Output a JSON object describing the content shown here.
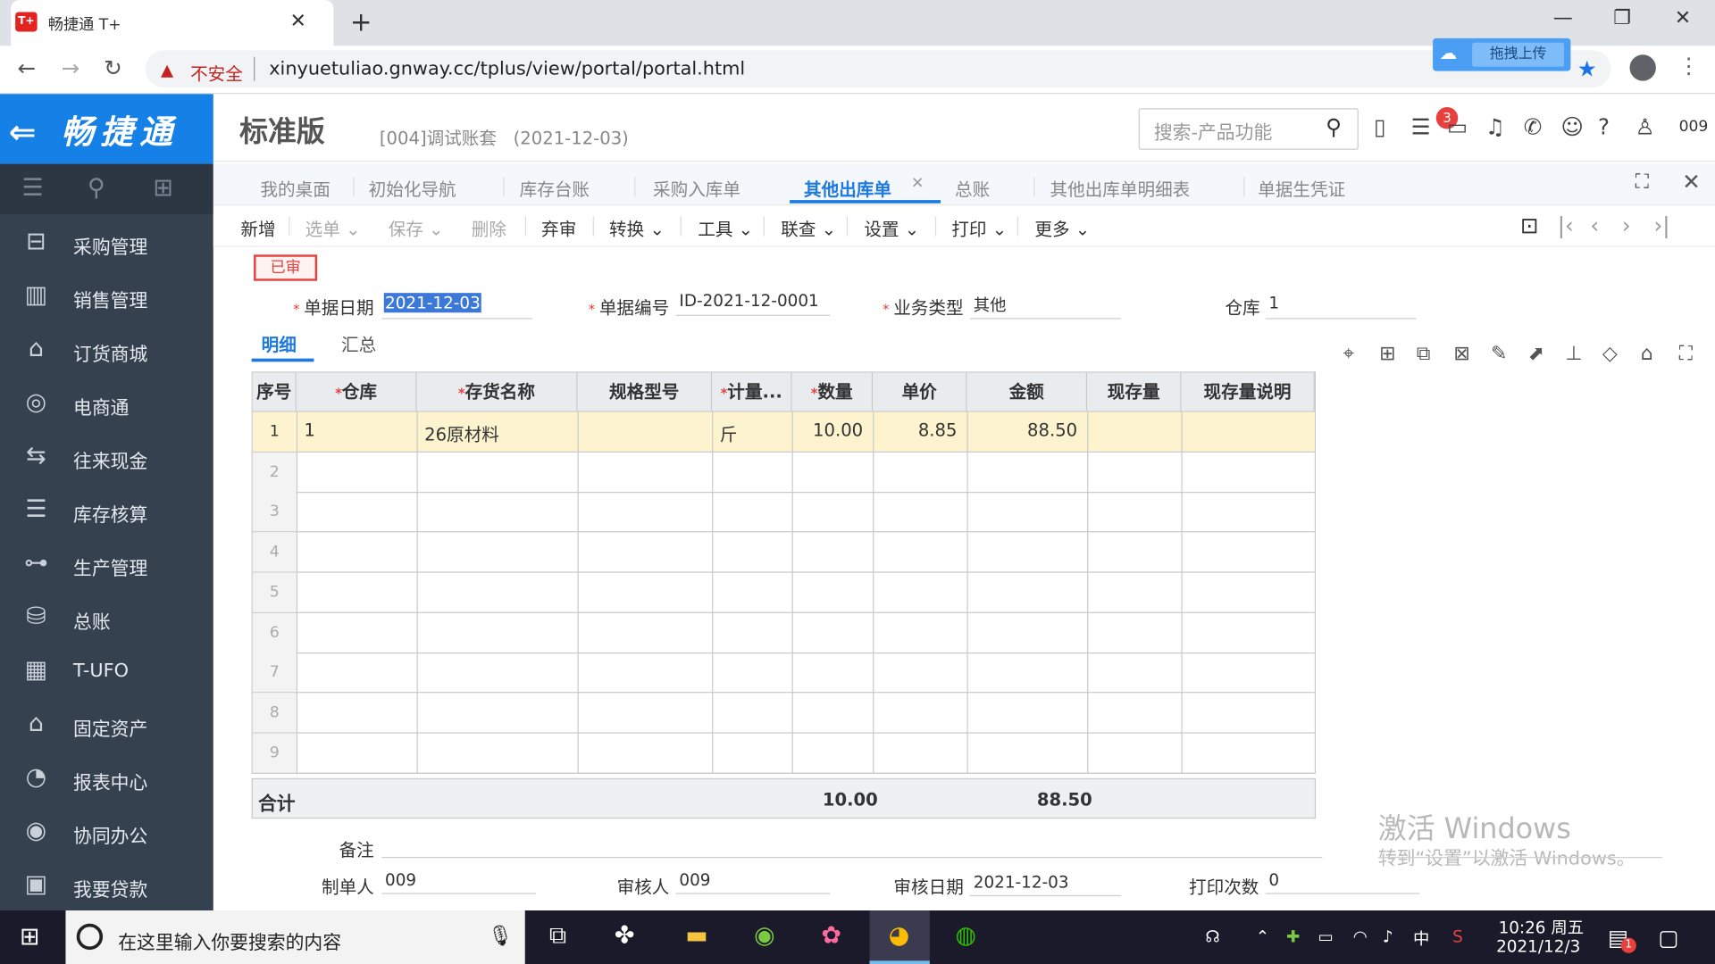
{
  "browser": {
    "tab_title": "畅捷通 T+",
    "tab_icon_text": "T+",
    "security_label": "不安全",
    "url": "xinyuetuliao.gnway.cc/tplus/view/portal/portal.html",
    "extension_label": "拖拽上传"
  },
  "app": {
    "logo": "畅捷通",
    "edition": "标准版",
    "account": "[004]调试账套",
    "account_date": "(2021-12-03)",
    "search_placeholder": "搜索-产品功能",
    "notification_count": "3",
    "user": "009"
  },
  "sidebar": {
    "items": [
      {
        "label": "采购管理",
        "icon": "purchase-icon"
      },
      {
        "label": "销售管理",
        "icon": "sales-icon"
      },
      {
        "label": "订货商城",
        "icon": "mall-icon"
      },
      {
        "label": "电商通",
        "icon": "ecommerce-icon"
      },
      {
        "label": "往来现金",
        "icon": "cash-icon"
      },
      {
        "label": "库存核算",
        "icon": "inventory-icon"
      },
      {
        "label": "生产管理",
        "icon": "production-icon"
      },
      {
        "label": "总账",
        "icon": "ledger-icon"
      },
      {
        "label": "T-UFO",
        "icon": "ufo-icon"
      },
      {
        "label": "固定资产",
        "icon": "asset-icon"
      },
      {
        "label": "报表中心",
        "icon": "report-icon"
      },
      {
        "label": "协同办公",
        "icon": "office-icon"
      },
      {
        "label": "我要贷款",
        "icon": "loan-icon"
      }
    ]
  },
  "page_tabs": {
    "items": [
      "我的桌面",
      "初始化导航",
      "库存台账",
      "采购入库单",
      "其他出库单",
      "总账",
      "其他出库单明细表",
      "单据生凭证"
    ],
    "active": "其他出库单"
  },
  "toolbar": {
    "new": "新增",
    "select": "选单",
    "save": "保存",
    "delete": "删除",
    "unaudit": "弃审",
    "convert": "转换",
    "tools": "工具",
    "linkquery": "联查",
    "settings": "设置",
    "print": "打印",
    "more": "更多"
  },
  "form": {
    "status": "已审",
    "date_label": "单据日期",
    "date": "2021-12-03",
    "code_label": "单据编号",
    "code": "ID-2021-12-0001",
    "biztype_label": "业务类型",
    "biztype": "其他",
    "warehouse_label": "仓库",
    "warehouse": "1",
    "subtabs": [
      "明细",
      "汇总"
    ]
  },
  "grid": {
    "columns": [
      "序号",
      "仓库",
      "存货名称",
      "规格型号",
      "计量...",
      "数量",
      "单价",
      "金额",
      "现存量",
      "现存量说明"
    ],
    "rows": [
      {
        "no": "1",
        "warehouse": "1",
        "name": "26原材料",
        "spec": "",
        "unit": "斤",
        "qty": "10.00",
        "price": "8.85",
        "amount": "88.50"
      }
    ],
    "empty_rows": [
      "2",
      "3",
      "4",
      "5",
      "6",
      "7",
      "8",
      "9"
    ],
    "total_label": "合计",
    "total_qty": "10.00",
    "total_amount": "88.50"
  },
  "footer": {
    "remark_label": "备注",
    "maker_label": "制单人",
    "maker": "009",
    "auditor_label": "审核人",
    "auditor": "009",
    "audit_date_label": "审核日期",
    "audit_date": "2021-12-03",
    "print_count_label": "打印次数",
    "print_count": "0"
  },
  "watermark": {
    "line1": "激活 Windows",
    "line2": "转到“设置”以激活 Windows。"
  },
  "taskbar": {
    "search_placeholder": "在这里输入你要搜索的内容",
    "ime": "中",
    "time": "10:26 周五",
    "date": "2021/12/3",
    "notif_count": "1"
  },
  "colors": {
    "accent": "#1f7ae0",
    "sidebar": "#36414f",
    "logo": "#1580e5",
    "row_highlight": "#fdf4cf",
    "required": "#e8403c"
  }
}
